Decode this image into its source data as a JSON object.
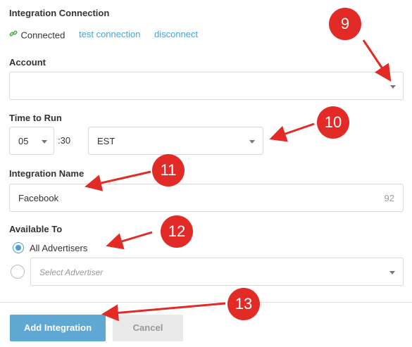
{
  "integration": {
    "section_label": "Integration Connection",
    "status": "Connected",
    "test_link": "test connection",
    "disconnect_link": "disconnect"
  },
  "account": {
    "label": "Account",
    "value": ""
  },
  "time_to_run": {
    "label": "Time to Run",
    "hour": "05",
    "minutes": ":30",
    "timezone": "EST"
  },
  "integration_name": {
    "label": "Integration Name",
    "value": "Facebook",
    "char_remaining": "92"
  },
  "available_to": {
    "label": "Available To",
    "option_all": "All Advertisers",
    "select_placeholder": "Select Advertiser"
  },
  "actions": {
    "add_label": "Add Integration",
    "cancel_label": "Cancel"
  },
  "annotations": [
    "9",
    "10",
    "11",
    "12",
    "13"
  ],
  "colors": {
    "accent": "#4a9fd4",
    "link": "#4aa3d6",
    "connected_icon": "#4caf50",
    "primary_button": "#5fa8d3",
    "annotation": "#e22b26"
  },
  "icons": {
    "connected": "link-icon",
    "dropdown": "chevron-down-icon"
  }
}
